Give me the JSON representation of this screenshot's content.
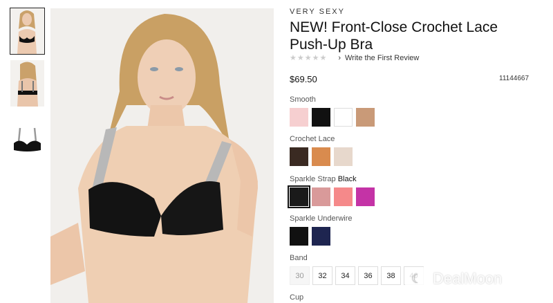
{
  "product": {
    "brand": "VERY SEXY",
    "title": "NEW! Front-Close Crochet Lace Push-Up Bra",
    "stars": "★★★★★",
    "review_link": "Write the First Review",
    "price": "$69.50",
    "sku": "11144667"
  },
  "groups": {
    "smooth": {
      "label": "Smooth",
      "swatches": [
        "#f6cfd0",
        "#111111",
        "#ffffff",
        "#c99a78"
      ]
    },
    "crochet": {
      "label": "Crochet Lace",
      "swatches": [
        "#3a2a22",
        "#d98b4e",
        "#e7d8cc"
      ]
    },
    "sparkle_strap": {
      "label": "Sparkle Strap",
      "selected_value": "Black",
      "swatches": [
        "#1a1a1a",
        "#d99a9a",
        "#f5898a",
        "#c433a6"
      ]
    },
    "sparkle_underwire": {
      "label": "Sparkle Underwire",
      "swatches": [
        "#111111",
        "#1e2550"
      ]
    }
  },
  "band": {
    "label": "Band",
    "sizes": [
      "30",
      "32",
      "34",
      "36",
      "38",
      "40"
    ]
  },
  "cup": {
    "label": "Cup"
  },
  "watermark": {
    "text": "DealMoon"
  }
}
